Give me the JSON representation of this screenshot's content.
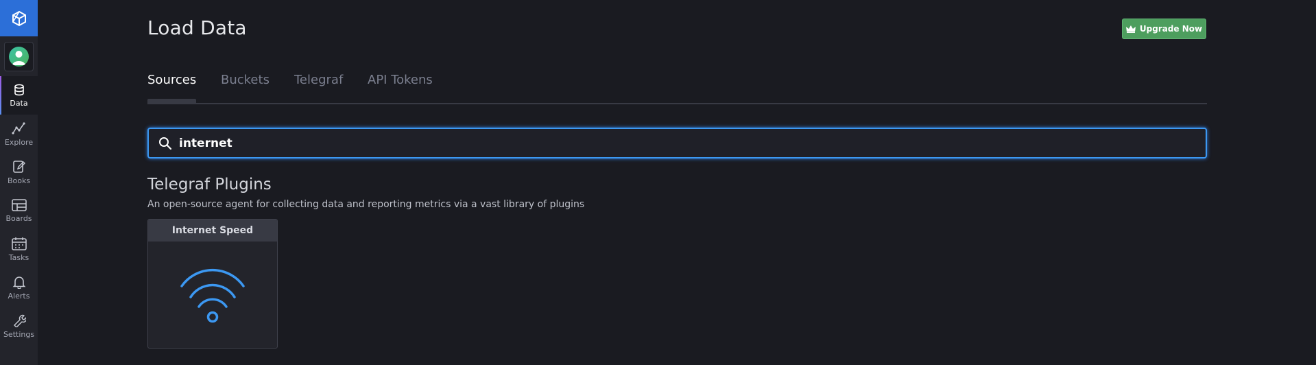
{
  "app": {
    "brand_icon": "influx-logo-icon"
  },
  "sidebar": {
    "avatar": "user-avatar",
    "items": [
      {
        "label": "Data",
        "icon": "database-icon",
        "active": true
      },
      {
        "label": "Explore",
        "icon": "graph-line-icon"
      },
      {
        "label": "Books",
        "icon": "notebook-icon"
      },
      {
        "label": "Boards",
        "icon": "dashboard-grid-icon"
      },
      {
        "label": "Tasks",
        "icon": "calendar-icon"
      },
      {
        "label": "Alerts",
        "icon": "bell-icon"
      },
      {
        "label": "Settings",
        "icon": "wrench-icon"
      }
    ]
  },
  "header": {
    "title": "Load Data",
    "upgrade_label": "Upgrade Now"
  },
  "tabs": [
    {
      "label": "Sources",
      "active": true
    },
    {
      "label": "Buckets"
    },
    {
      "label": "Telegraf"
    },
    {
      "label": "API Tokens"
    }
  ],
  "search": {
    "value": "internet",
    "icon": "search-icon"
  },
  "section": {
    "title": "Telegraf Plugins",
    "description": "An open-source agent for collecting data and reporting metrics via a vast library of plugins"
  },
  "cards": [
    {
      "title": "Internet Speed",
      "icon": "wifi-icon"
    }
  ],
  "colors": {
    "accent": "#3c98f2",
    "upgrade": "#4d9e5e",
    "background": "#1a1b21",
    "sidebar": "#23242b"
  }
}
